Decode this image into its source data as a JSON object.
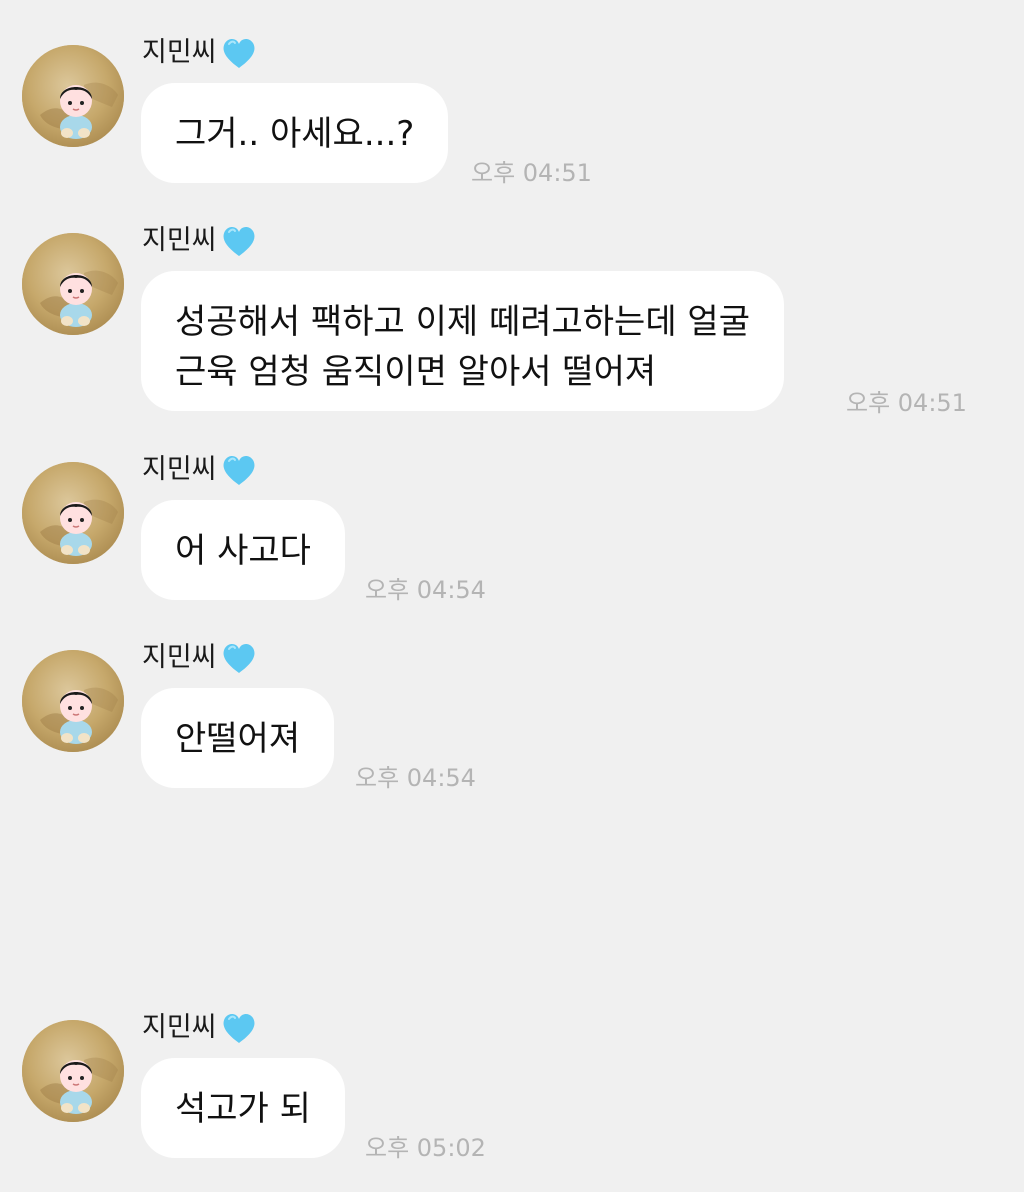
{
  "messages": [
    {
      "sender": "지민씨",
      "text": "그거.. 아세요...?",
      "time": "오후 04:51"
    },
    {
      "sender": "지민씨",
      "text": "성공해서 팩하고 이제 떼려고하는데 얼굴\n근육 엄청 움직이면 알아서 떨어져",
      "time": "오후 04:51"
    },
    {
      "sender": "지민씨",
      "text": "어 사고다",
      "time": "오후 04:54"
    },
    {
      "sender": "지민씨",
      "text": "안떨어져",
      "time": "오후 04:54"
    },
    {
      "sender": "지민씨",
      "text": "석고가 되",
      "time": "오후 05:02"
    }
  ],
  "icons": {
    "heart": "light-blue-heart-icon",
    "avatar": "cartoon-child-avatar"
  },
  "colors": {
    "background": "#f0f0f0",
    "bubble": "#ffffff",
    "timestamp": "#b4b4b4",
    "heart": "#5cc8f2"
  }
}
